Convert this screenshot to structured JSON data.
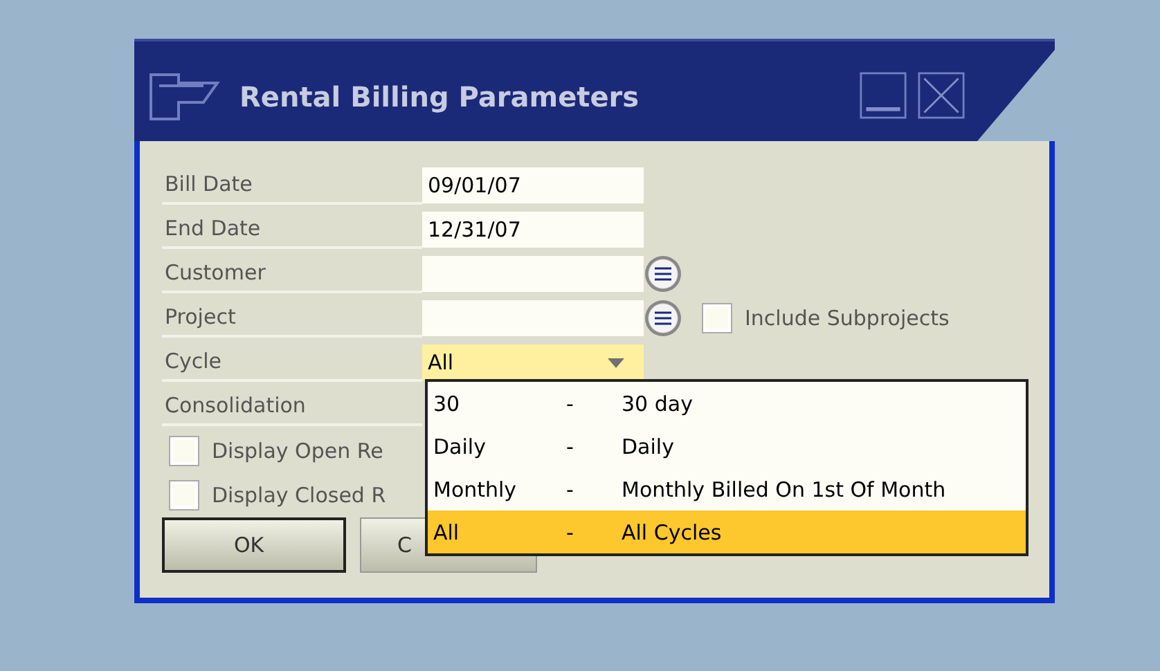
{
  "window": {
    "title": "Rental Billing Parameters"
  },
  "fields": [
    {
      "label": "Bill Date",
      "kind": "text",
      "value": "09/01/07"
    },
    {
      "label": "End Date",
      "kind": "text",
      "value": "12/31/07"
    },
    {
      "label": "Customer",
      "kind": "lookup"
    },
    {
      "label": "Project",
      "kind": "lookup",
      "option": {
        "label": "Include Subprojects",
        "checked": false
      }
    },
    {
      "label": "Cycle",
      "kind": "dropdown",
      "value": "All",
      "expanded": true
    },
    {
      "label": "Consolidation",
      "kind": "covered"
    }
  ],
  "checkboxes": [
    {
      "label": "Display Open Re",
      "checked": false
    },
    {
      "label": "Display Closed R",
      "checked": false
    }
  ],
  "buttons": [
    {
      "label": "OK",
      "default": true
    },
    {
      "label": "C",
      "default": false
    }
  ],
  "dropdown": {
    "options": [
      {
        "code": "30",
        "separator": "-",
        "description": "30 day",
        "selected": false
      },
      {
        "code": "Daily",
        "separator": "-",
        "description": "Daily",
        "selected": false
      },
      {
        "code": "Monthly",
        "separator": "-",
        "description": "Monthly Billed On 1st Of Month",
        "selected": false
      },
      {
        "code": "All",
        "separator": "-",
        "description": "All Cycles",
        "selected": true
      }
    ]
  }
}
